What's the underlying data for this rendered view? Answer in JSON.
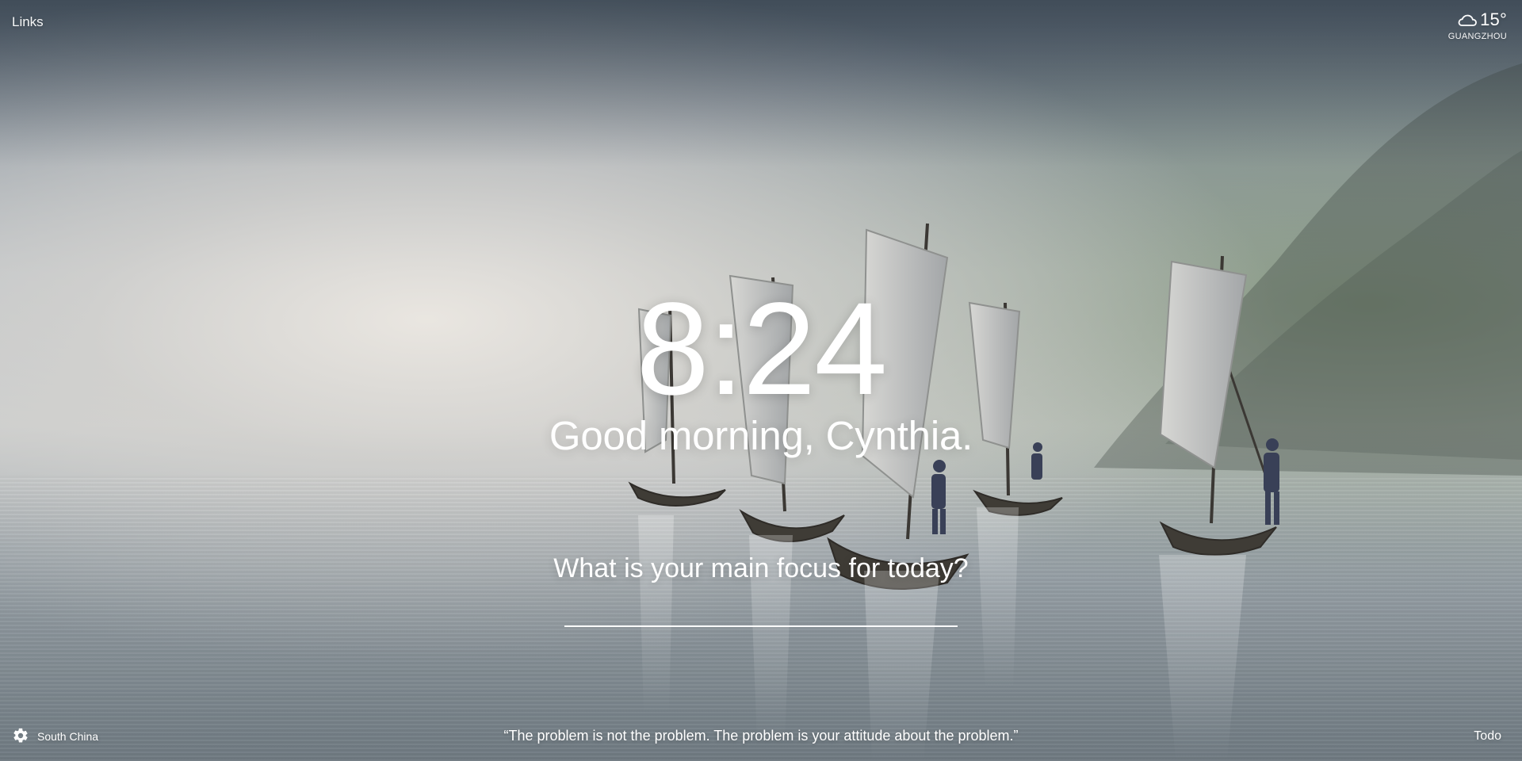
{
  "header": {
    "links_label": "Links"
  },
  "weather": {
    "temperature": "15°",
    "city": "GUANGZHOU",
    "icon": "cloud-icon"
  },
  "main": {
    "time": "8:24",
    "greeting": "Good morning, Cynthia.",
    "focus_prompt": "What is your main focus for today?",
    "focus_value": ""
  },
  "footer": {
    "location": "South China",
    "quote": "“The problem is not the problem. The problem is your attitude about the problem.”",
    "todo_label": "Todo",
    "settings_icon": "gear-icon"
  },
  "colors": {
    "text": "#ffffff",
    "sky_top": "#5f6b77",
    "mist": "#e8e4de",
    "water": "#8f99a3"
  }
}
